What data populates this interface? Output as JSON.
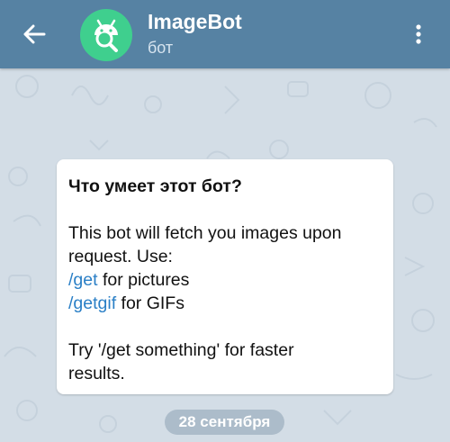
{
  "header": {
    "title": "ImageBot",
    "subtitle": "бот",
    "icons": {
      "back": "arrow-left-icon",
      "menu": "more-vertical-icon",
      "avatar": "android-search-logo"
    }
  },
  "bot_info": {
    "heading": "Что умеет этот бот?",
    "description_line1": "This bot will fetch you images upon",
    "description_line2": "request. Use:",
    "commands": [
      {
        "command": "/get",
        "text": " for pictures"
      },
      {
        "command": "/getgif",
        "text": " for GIFs"
      }
    ],
    "tip_line1": "Try '/get something' for faster",
    "tip_line2": "results."
  },
  "date_separator": "28 сентября",
  "colors": {
    "header_bg": "#5682a3",
    "avatar_bg": "#3fcf8e",
    "link": "#2a7fc6",
    "chat_bg": "#d3dde6"
  }
}
